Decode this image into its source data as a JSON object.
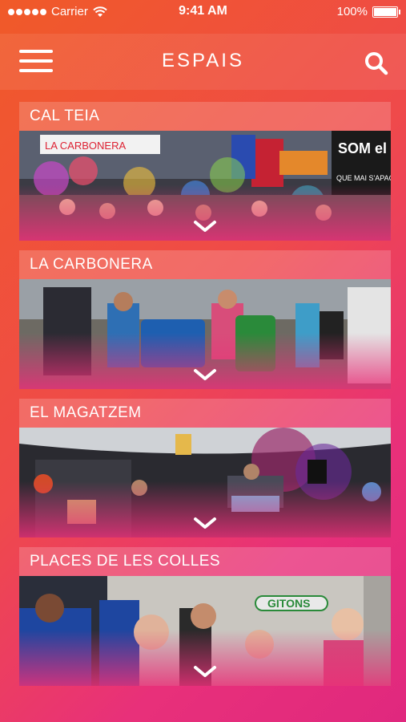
{
  "status_bar": {
    "carrier": "Carrier",
    "time": "9:41 AM",
    "battery": "100%"
  },
  "nav": {
    "title": "ESPAIS",
    "icons": {
      "menu": "hamburger-menu-icon",
      "search": "search-icon"
    }
  },
  "spaces": [
    {
      "name": "CAL TEIA",
      "banner_1": "LA CARBONERA",
      "banner_2": "SOM el FOC",
      "banner_3": "QUE MAI S'APAGA"
    },
    {
      "name": "LA CARBONERA"
    },
    {
      "name": "EL MAGATZEM"
    },
    {
      "name": "PLACES DE LES COLLES",
      "banner_1": "GITONS"
    }
  ],
  "colors": {
    "gradient_start": "#f05a28",
    "gradient_end": "#e0287e",
    "text": "#ffffff"
  }
}
